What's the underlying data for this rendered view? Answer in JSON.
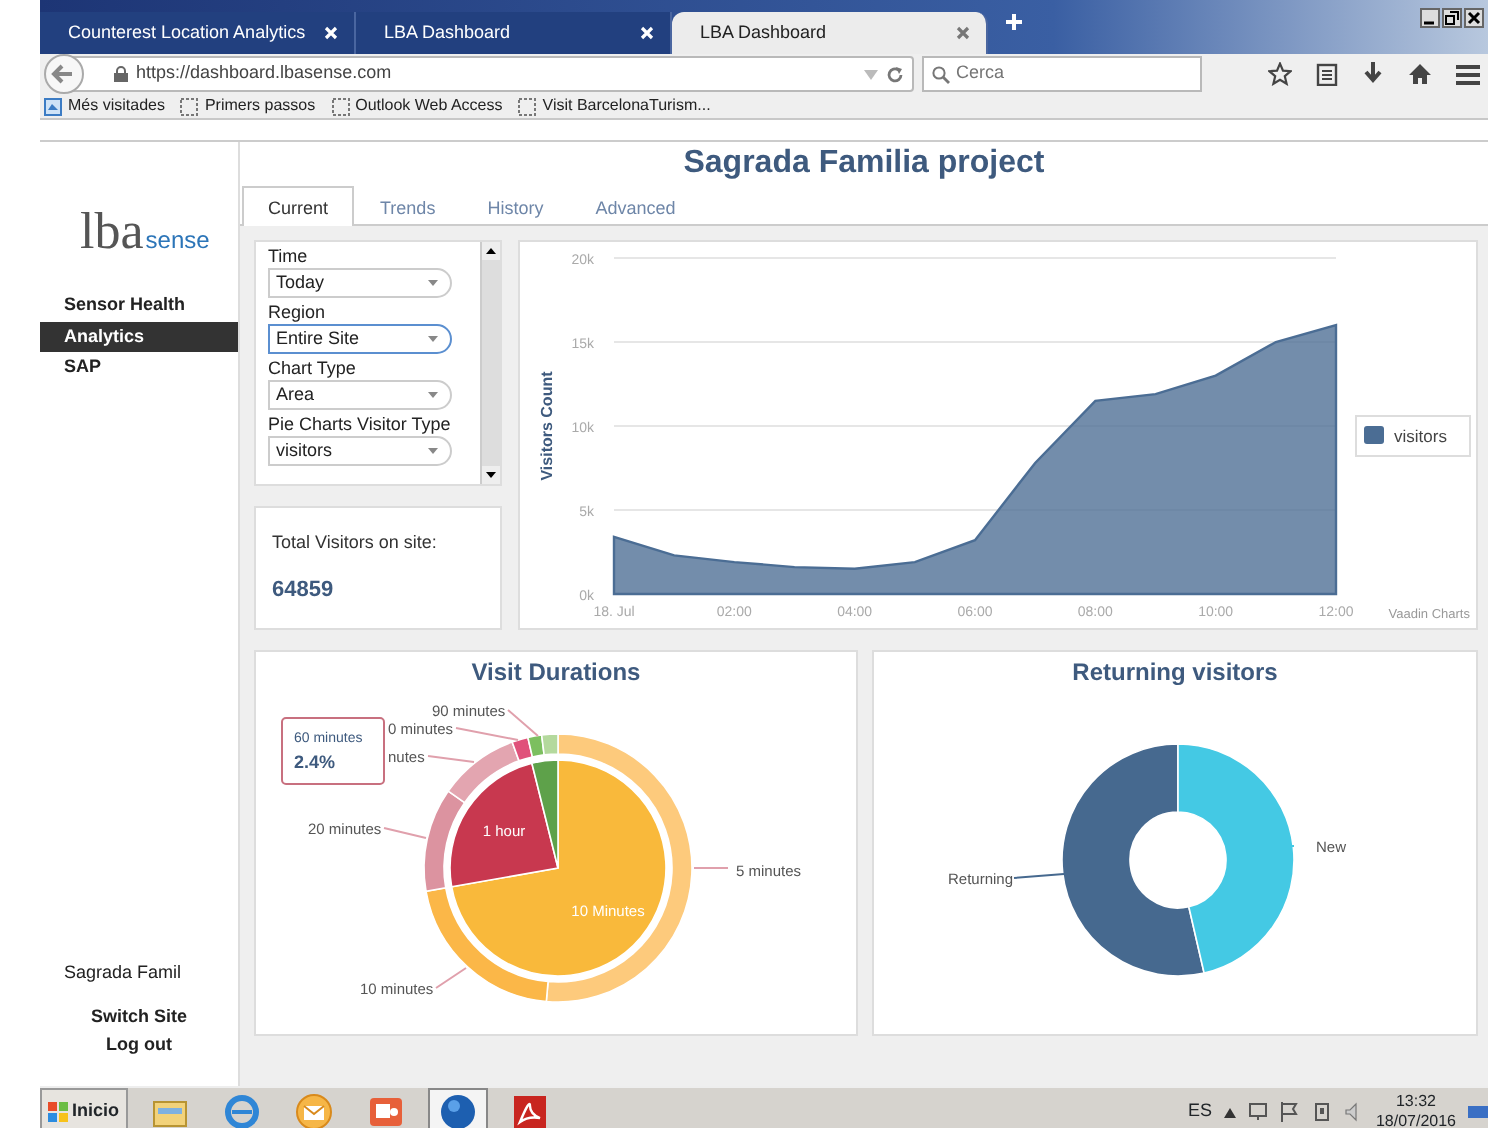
{
  "browser": {
    "tabs": [
      {
        "title": "Counterest Location Analytics",
        "selected": false
      },
      {
        "title": "LBA Dashboard",
        "selected": false
      },
      {
        "title": "LBA Dashboard",
        "selected": true
      }
    ],
    "address": "https://dashboard.lbasense.com",
    "search": {
      "placeholder": "Cerca"
    },
    "bookmarks": [
      {
        "label": "Més visitades",
        "kind": "special"
      },
      {
        "label": "Primers passos",
        "kind": "folder"
      },
      {
        "label": "Outlook Web Access",
        "kind": "folder"
      },
      {
        "label": "Visit BarcelonaTurism...",
        "kind": "folder"
      }
    ]
  },
  "sidebar": {
    "logo": {
      "main": "lba",
      "suffix": "sense"
    },
    "items": [
      {
        "label": "Sensor Health",
        "selected": false
      },
      {
        "label": "Analytics",
        "selected": true
      },
      {
        "label": "SAP",
        "selected": false
      }
    ],
    "site": "Sagrada Famil",
    "links": [
      "Switch Site",
      "Log out"
    ]
  },
  "page_title": "Sagrada Familia project",
  "tabs": [
    {
      "label": "Current",
      "selected": true
    },
    {
      "label": "Trends",
      "selected": false
    },
    {
      "label": "History",
      "selected": false
    },
    {
      "label": "Advanced",
      "selected": false
    }
  ],
  "filters": [
    {
      "label": "Time",
      "value": "Today",
      "focused": false
    },
    {
      "label": "Region",
      "value": "Entire Site",
      "focused": true
    },
    {
      "label": "Chart Type",
      "value": "Area",
      "focused": false
    },
    {
      "label": "Pie Charts Visitor Type",
      "value": "visitors",
      "focused": false
    }
  ],
  "total": {
    "label": "Total Visitors on site:",
    "value": "64859"
  },
  "visitors_chart": {
    "chart_data": {
      "type": "area",
      "ylabel": "Visitors Count",
      "x": [
        0,
        1,
        2,
        3,
        4,
        5,
        6,
        7,
        8,
        9,
        10,
        11,
        12
      ],
      "series": [
        {
          "name": "visitors",
          "color": "#4b6d94",
          "values": [
            3400,
            2300,
            1900,
            1600,
            1500,
            1900,
            3200,
            7800,
            11500,
            11900,
            13000,
            15000,
            16000
          ]
        }
      ],
      "xticks": [
        {
          "value": 0,
          "label": "18. Jul"
        },
        {
          "value": 2,
          "label": "02:00"
        },
        {
          "value": 4,
          "label": "04:00"
        },
        {
          "value": 6,
          "label": "06:00"
        },
        {
          "value": 8,
          "label": "08:00"
        },
        {
          "value": 10,
          "label": "10:00"
        },
        {
          "value": 12,
          "label": "12:00"
        }
      ],
      "xlim": [
        0,
        12
      ],
      "grid": true,
      "ylim": [
        0,
        20000
      ],
      "yticks": [
        {
          "value": 0,
          "label": "0k"
        },
        {
          "value": 5000,
          "label": "5k"
        },
        {
          "value": 10000,
          "label": "10k"
        },
        {
          "value": 15000,
          "label": "15k"
        },
        {
          "value": 20000,
          "label": "20k"
        }
      ]
    },
    "credit": "Vaadin Charts"
  },
  "durations": {
    "title": "Visit Durations",
    "outer_labels": [
      "90 minutes",
      "0 minutes",
      "nutes",
      "20 minutes",
      "5 minutes",
      "10 minutes"
    ],
    "inner_labels": [
      "1 hour",
      "10 Minutes"
    ],
    "tooltip": {
      "label": "60 minutes",
      "value": "2.4%"
    }
  },
  "returning": {
    "title": "Returning visitors",
    "labels": [
      "Returning",
      "New"
    ]
  },
  "taskbar": {
    "start": "Inicio",
    "apps": [
      {
        "kind": "folder",
        "selected": false
      },
      {
        "kind": "browser",
        "selected": false
      },
      {
        "kind": "mail",
        "selected": false
      },
      {
        "kind": "slides",
        "selected": false
      },
      {
        "kind": "globe",
        "selected": true
      },
      {
        "kind": "pdf",
        "selected": false
      }
    ],
    "language": "ES",
    "time": "13:32",
    "date": "18/07/2016"
  }
}
